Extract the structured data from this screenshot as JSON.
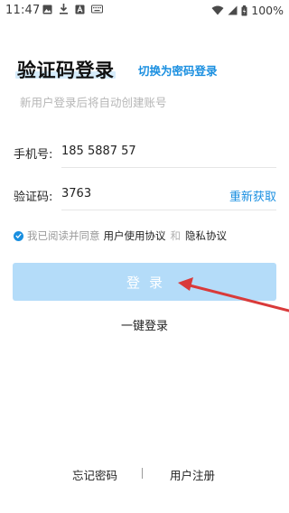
{
  "status_bar": {
    "time": "11:47",
    "left_icons": [
      "image-icon",
      "download-icon",
      "font-icon",
      "keyboard-icon"
    ],
    "battery": "100%"
  },
  "header": {
    "title": "验证码登录",
    "switch_label": "切换为密码登录",
    "subtitle": "新用户登录后将自动创建账号"
  },
  "form": {
    "phone_label": "手机号:",
    "phone_value": "185 5887 57",
    "code_label": "验证码:",
    "code_value": "3763",
    "resend_label": "重新获取"
  },
  "agreement": {
    "prefix": "我已阅读并同意",
    "user_agreement": "用户使用协议",
    "and": "和",
    "privacy_policy": "隐私协议",
    "checked": true
  },
  "actions": {
    "login_label": "登录",
    "one_key_login": "一键登录"
  },
  "footer": {
    "forgot_password": "忘记密码",
    "register": "用户注册"
  },
  "colors": {
    "accent": "#1a8fe0",
    "button_disabled": "#b4dcf9",
    "annotation_arrow": "#d93a3a"
  }
}
